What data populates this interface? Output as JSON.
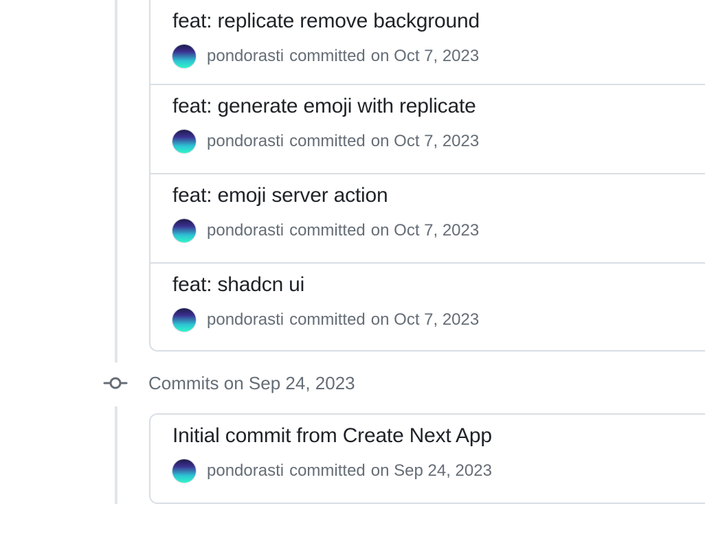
{
  "groups": [
    {
      "header": "",
      "commits": [
        {
          "title": "feat: replicate remove background",
          "author": "pondorasti",
          "action": "committed",
          "date": "on Oct 7, 2023"
        },
        {
          "title": "feat: generate emoji with replicate",
          "author": "pondorasti",
          "action": "committed",
          "date": "on Oct 7, 2023"
        },
        {
          "title": "feat: emoji server action",
          "author": "pondorasti",
          "action": "committed",
          "date": "on Oct 7, 2023"
        },
        {
          "title": "feat: shadcn ui",
          "author": "pondorasti",
          "action": "committed",
          "date": "on Oct 7, 2023"
        }
      ]
    },
    {
      "header": "Commits on Sep 24, 2023",
      "commits": [
        {
          "title": "Initial commit from Create Next App",
          "author": "pondorasti",
          "action": "committed",
          "date": "on Sep 24, 2023"
        }
      ]
    }
  ],
  "icons": {
    "avatar": "avatar-gradient-icon",
    "timeline_node": "git-commit-icon"
  },
  "colors": {
    "title": "#1f2328",
    "muted": "#656d76",
    "border": "#d8dee4",
    "timeline": "#e1e4e8"
  }
}
